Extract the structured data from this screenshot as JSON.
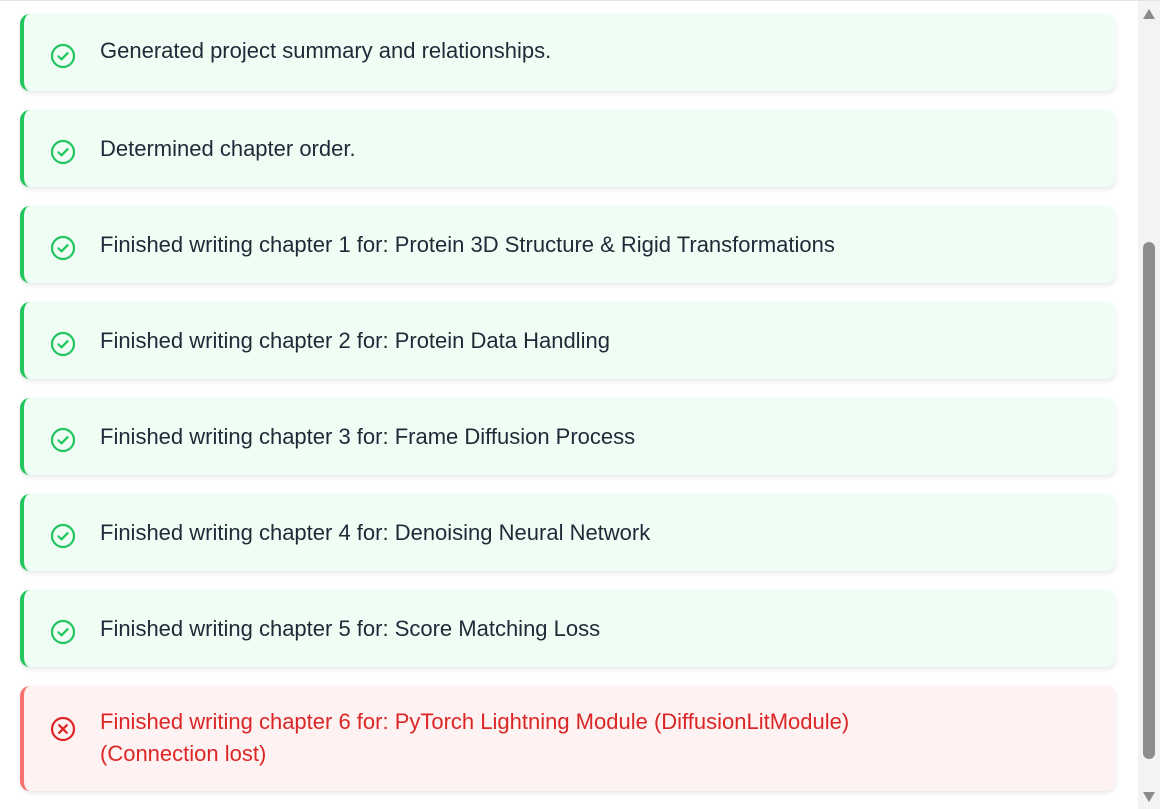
{
  "colors": {
    "success_bg": "#f0fdf4",
    "success_accent": "#22c55e",
    "error_bg": "#fef2f2",
    "error_accent": "#dc2626"
  },
  "log": {
    "entries": [
      {
        "status": "success",
        "icon": "check-circle-icon",
        "text": "Generated project summary and relationships."
      },
      {
        "status": "success",
        "icon": "check-circle-icon",
        "text": "Determined chapter order."
      },
      {
        "status": "success",
        "icon": "check-circle-icon",
        "text": "Finished writing chapter 1 for: Protein 3D Structure & Rigid Transformations"
      },
      {
        "status": "success",
        "icon": "check-circle-icon",
        "text": "Finished writing chapter 2 for: Protein Data Handling"
      },
      {
        "status": "success",
        "icon": "check-circle-icon",
        "text": "Finished writing chapter 3 for: Frame Diffusion Process"
      },
      {
        "status": "success",
        "icon": "check-circle-icon",
        "text": "Finished writing chapter 4 for: Denoising Neural Network"
      },
      {
        "status": "success",
        "icon": "check-circle-icon",
        "text": "Finished writing chapter 5 for: Score Matching Loss"
      },
      {
        "status": "error",
        "icon": "x-circle-icon",
        "text": "Finished writing chapter 6 for: PyTorch Lightning Module (DiffusionLitModule)",
        "detail": "(Connection lost)"
      }
    ]
  },
  "scrollbar": {
    "up_icon": "arrow-up-icon",
    "down_icon": "arrow-down-icon",
    "thumb_start_fraction": 0.285,
    "thumb_size_fraction": 0.68
  }
}
